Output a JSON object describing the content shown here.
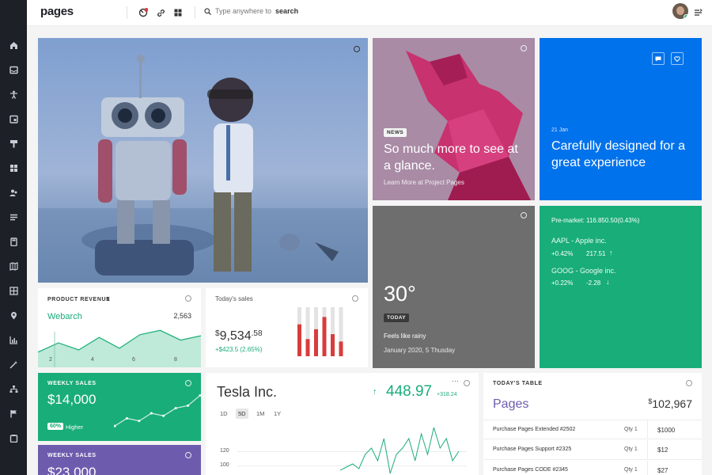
{
  "app": {
    "logo": "pages"
  },
  "search": {
    "prefix": "Type anywhere to",
    "keyword": "search"
  },
  "hero": {
    "title": "",
    "subtitle": ""
  },
  "news_card": {
    "badge": "NEWS",
    "headline": "So much more to see at a glance.",
    "link": "Learn More at Project Pages"
  },
  "blue_card": {
    "date": "21 Jan",
    "headline": "Carefully designed for a great experience"
  },
  "weather": {
    "temp": "30°",
    "badge": "TODAY",
    "condition": "Feels like rainy",
    "date": "January 2020, 5 Thusday"
  },
  "stocks": {
    "premarket": "Pre-market: 116.850.50(0.43%)",
    "items": [
      {
        "name": "AAPL - Apple inc.",
        "change": "+0.42%",
        "value": "217.51",
        "arrow": "↑"
      },
      {
        "name": "GOOG - Google inc.",
        "change": "+0.22%",
        "value": "-2.28",
        "arrow": "↓"
      }
    ]
  },
  "revenue": {
    "title": "PRODUCT REVENUE",
    "chevron": "›",
    "company": "Webarch",
    "value": "2,563",
    "xticks": [
      "2",
      "4",
      "6",
      "8"
    ]
  },
  "sales": {
    "title": "Today's sales",
    "currency": "$",
    "whole": "9,534",
    "cents": ".58",
    "change": "+$423.5 (2.65%)"
  },
  "weekly_green": {
    "title": "WEEKLY SALES",
    "value": "$14,000",
    "badge": "60%",
    "badge_label": "Higher"
  },
  "weekly_purple": {
    "title": "WEEKLY SALES",
    "value": "$23,000"
  },
  "tesla": {
    "name": "Tesla Inc.",
    "arrow": "↑",
    "price": "448.97",
    "change": "+318.24",
    "menu": "···",
    "ranges": [
      "1D",
      "5D",
      "1M",
      "1Y"
    ],
    "active_range": "5D",
    "yticks": [
      "120",
      "100"
    ]
  },
  "table": {
    "title": "TODAY'S TABLE",
    "name": "Pages",
    "currency": "$",
    "total": "102,967",
    "rows": [
      {
        "item": "Purchase Pages Extended #2502",
        "qty": "Qty 1",
        "price": "$1000"
      },
      {
        "item": "Purchase Pages Support #2325",
        "qty": "Qty 1",
        "price": "$12"
      },
      {
        "item": "Purchase Pages CODE #2345",
        "qty": "Qty 1",
        "price": "$27"
      }
    ]
  },
  "colors": {
    "blue": "#0072ec",
    "green": "#19ad79",
    "purple": "#6d5cae",
    "dark": "#1e2027",
    "red": "#d83c3c"
  },
  "chart_data": [
    {
      "type": "area",
      "title": "Webarch",
      "x": [
        1,
        2,
        3,
        4,
        5,
        6,
        7,
        8,
        9
      ],
      "values": [
        28,
        45,
        32,
        55,
        35,
        60,
        68,
        50,
        58
      ],
      "xlabel": "",
      "ylabel": ""
    },
    {
      "type": "bar",
      "title": "Today's sales",
      "categories": [
        "1",
        "2",
        "3",
        "4",
        "5",
        "6"
      ],
      "values": [
        65,
        35,
        55,
        80,
        45,
        30
      ],
      "total": 100
    },
    {
      "type": "line",
      "title": "WEEKLY SALES",
      "x": [
        1,
        2,
        3,
        4,
        5,
        6,
        7,
        8
      ],
      "values": [
        20,
        35,
        30,
        45,
        40,
        55,
        60,
        80
      ]
    },
    {
      "type": "line",
      "title": "Tesla Inc.",
      "x": [
        1,
        2,
        3,
        4,
        5,
        6,
        7,
        8,
        9,
        10,
        11,
        12,
        13,
        14,
        15,
        16,
        17,
        18,
        19,
        20
      ],
      "values": [
        98,
        100,
        102,
        99,
        108,
        112,
        104,
        118,
        96,
        108,
        112,
        118,
        104,
        121,
        108,
        125,
        112,
        118,
        104,
        110
      ],
      "ylim": [
        95,
        125
      ]
    }
  ]
}
